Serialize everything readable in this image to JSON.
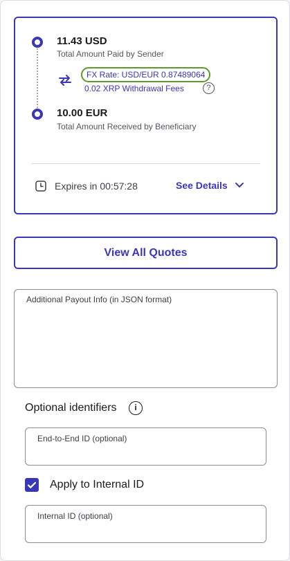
{
  "quote": {
    "sender_amount": "11.43 USD",
    "sender_label": "Total Amount Paid by Sender",
    "fx_rate": "FX Rate: USD/EUR 0.87489064",
    "fees": "0.02 XRP Withdrawal Fees",
    "help_glyph": "?",
    "beneficiary_amount": "10.00 EUR",
    "beneficiary_label": "Total Amount Received by Beneficiary",
    "expires": "Expires in 00:57:28",
    "see_details_label": "See Details",
    "icons": [
      "swap-icon",
      "help-icon",
      "clock-icon",
      "chevron-down-icon"
    ]
  },
  "actions": {
    "view_all_quotes_label": "View All Quotes"
  },
  "payout_info": {
    "label": "Additional Payout Info (in JSON format)",
    "value": ""
  },
  "identifiers": {
    "title": "Optional identifiers",
    "info_glyph": "i",
    "end_to_end": {
      "label": "End-to-End ID (optional)",
      "value": ""
    },
    "apply_internal": {
      "label": "Apply to Internal ID",
      "checked": true
    },
    "internal": {
      "label": "Internal ID (optional)",
      "value": ""
    }
  },
  "colors": {
    "accent": "#3a36b8",
    "highlight": "#5a9b2a",
    "border": "#8a8a93"
  }
}
